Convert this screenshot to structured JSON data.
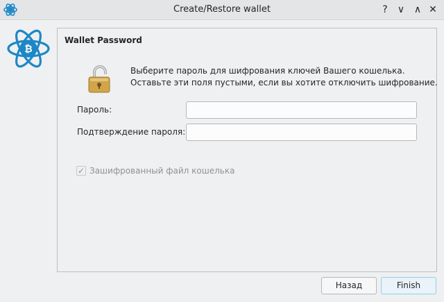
{
  "window": {
    "title": "Create/Restore wallet",
    "controls": {
      "help": "?",
      "minimize": "∨",
      "maximize": "∧",
      "close": "✕"
    }
  },
  "panel": {
    "title": "Wallet Password",
    "message_line1": "Выберите пароль для шифрования ключей Вашего кошелька.",
    "message_line2": "Оставьте эти поля пустыми, если вы хотите отключить шифрование.",
    "password_label": "Пароль:",
    "password_value": "",
    "confirm_label": "Подтверждение пароля:",
    "confirm_value": "",
    "encrypt_checkbox_label": "Зашифрованный файл кошелька",
    "encrypt_checkbox_checked": true,
    "encrypt_checkbox_enabled": false
  },
  "buttons": {
    "back": "Назад",
    "finish": "Finish"
  },
  "colors": {
    "accent": "#3daee9",
    "logo": "#1d87c6",
    "lock": "#d1a548"
  },
  "icons": {
    "app": "electrum-logo-icon",
    "lock": "padlock-open-icon"
  }
}
